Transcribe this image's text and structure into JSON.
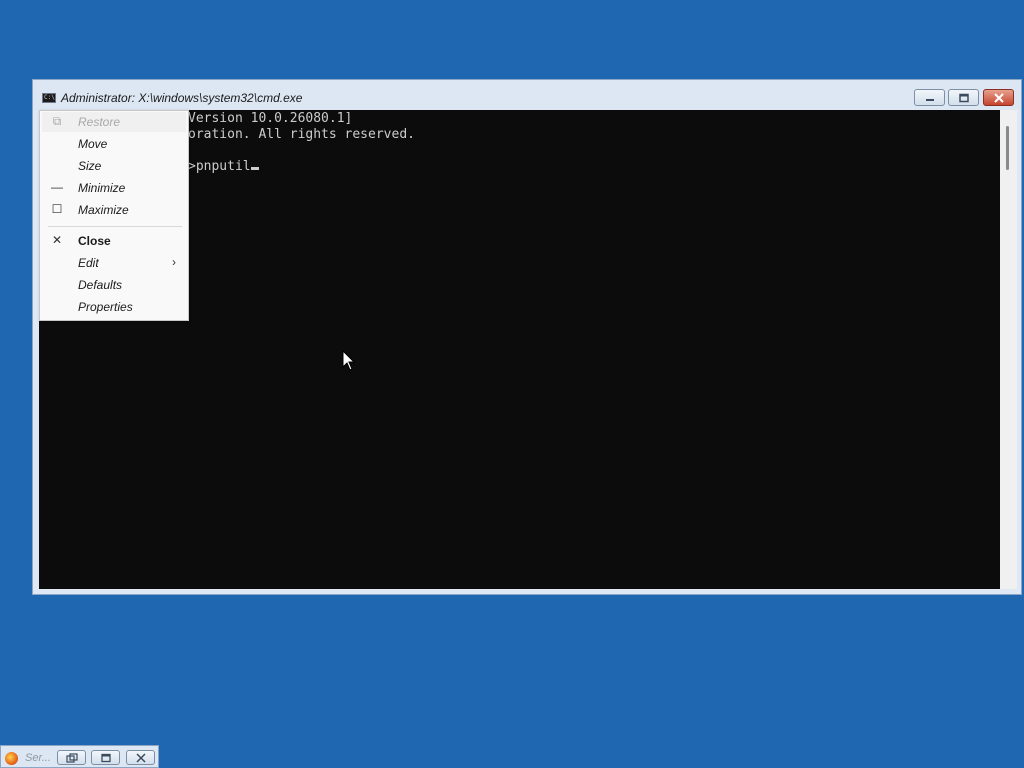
{
  "window": {
    "title": "Administrator: X:\\windows\\system32\\cmd.exe",
    "icon": "console-icon",
    "icon_text": "C:\\",
    "buttons": [
      "minimize-icon",
      "restore-icon",
      "close-icon"
    ]
  },
  "console": {
    "lines": [
      "Version 10.0.26080.1]",
      "oration. All rights reserved.",
      "",
      ">pnputil"
    ]
  },
  "system_menu": {
    "items": [
      {
        "label": "Restore",
        "icon": "restore-icon",
        "icon_glyph": "⧉",
        "disabled": true
      },
      {
        "label": "Move",
        "icon": "",
        "icon_glyph": ""
      },
      {
        "label": "Size",
        "icon": "",
        "icon_glyph": ""
      },
      {
        "label": "Minimize",
        "icon": "minimize-icon",
        "icon_glyph": "—"
      },
      {
        "label": "Maximize",
        "icon": "maximize-icon",
        "icon_glyph": "☐"
      },
      {
        "label": "Close",
        "icon": "close-icon",
        "icon_glyph": "✕",
        "bold": true
      },
      {
        "label": "Edit",
        "icon": "",
        "icon_glyph": "",
        "submenu": true,
        "arrow": "›"
      },
      {
        "label": "Defaults",
        "icon": "",
        "icon_glyph": ""
      },
      {
        "label": "Properties",
        "icon": "",
        "icon_glyph": ""
      }
    ]
  },
  "minimized_window": {
    "title": "Ser...",
    "icon": "setup-icon",
    "buttons": [
      "restore-icon",
      "maximize-icon",
      "close-icon"
    ]
  },
  "colors": {
    "desktop": "#1f67b1",
    "console_bg": "#0c0c0c",
    "console_fg": "#cccccc"
  }
}
